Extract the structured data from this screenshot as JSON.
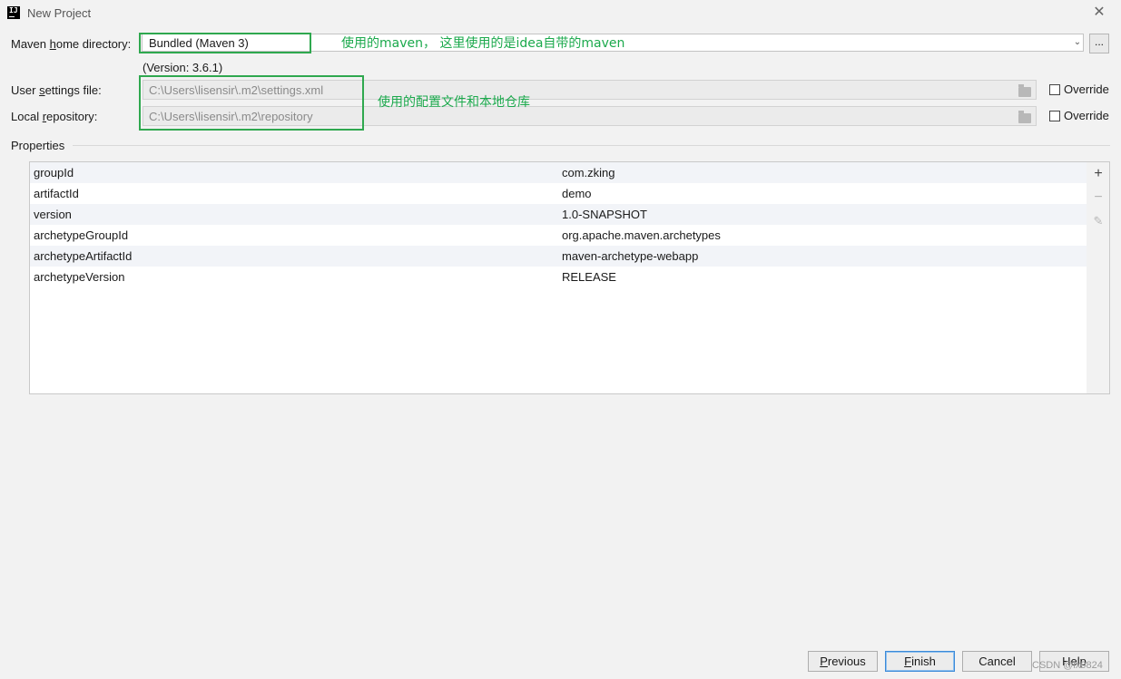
{
  "window": {
    "title": "New Project"
  },
  "maven_home": {
    "label_prefix": "Maven ",
    "label_mnemonic": "h",
    "label_suffix": "ome directory:",
    "value": "Bundled (Maven 3)",
    "version": "(Version: 3.6.1)",
    "browse_label": "..."
  },
  "user_settings": {
    "label_prefix": "User ",
    "label_mnemonic": "s",
    "label_suffix": "ettings file:",
    "value": "C:\\Users\\lisensir\\.m2\\settings.xml",
    "override_label": "Override"
  },
  "local_repo": {
    "label_prefix": "Local ",
    "label_mnemonic": "r",
    "label_suffix": "epository:",
    "value": "C:\\Users\\lisensir\\.m2\\repository",
    "override_label": "Override"
  },
  "annotations": {
    "maven_note": "使用的maven， 这里使用的是idea自带的maven",
    "config_note": "使用的配置文件和本地仓库",
    "color": "#1ba94c"
  },
  "properties": {
    "section_title": "Properties",
    "rows": [
      {
        "key": "groupId",
        "value": "com.zking"
      },
      {
        "key": "artifactId",
        "value": "demo"
      },
      {
        "key": "version",
        "value": "1.0-SNAPSHOT"
      },
      {
        "key": "archetypeGroupId",
        "value": "org.apache.maven.archetypes"
      },
      {
        "key": "archetypeArtifactId",
        "value": "maven-archetype-webapp"
      },
      {
        "key": "archetypeVersion",
        "value": "RELEASE"
      }
    ],
    "toolbar": {
      "add": "+",
      "remove": "−",
      "edit": "✎"
    }
  },
  "buttons": {
    "previous_mnemonic": "P",
    "previous_rest": "revious",
    "finish_mnemonic": "F",
    "finish_rest": "inish",
    "cancel": "Cancel",
    "help": "Help"
  },
  "watermark": "CSDN @lx0824",
  "icons": {
    "app": "intellij-idea-icon",
    "close": "close-icon",
    "dropdown": "chevron-down-icon",
    "folder": "folder-icon"
  }
}
